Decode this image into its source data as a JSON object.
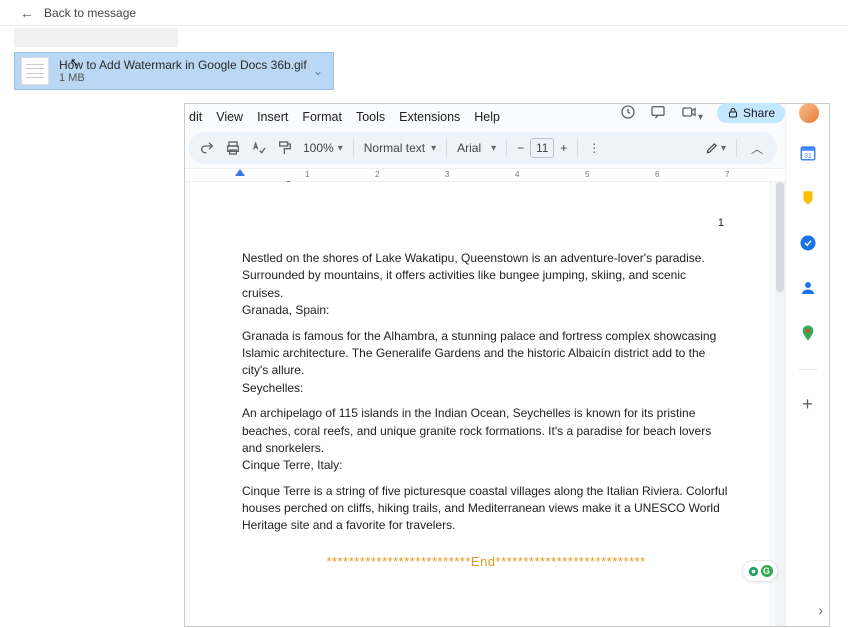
{
  "back_link": "Back to message",
  "attachment": {
    "name": "How to Add Watermark in Google Docs 36b.gif",
    "size": "1 MB"
  },
  "menus": {
    "edit": "dit",
    "view": "View",
    "insert": "Insert",
    "format": "Format",
    "tools": "Tools",
    "extensions": "Extensions",
    "help": "Help"
  },
  "toolbar": {
    "zoom": "100%",
    "style": "Normal text",
    "font": "Arial",
    "fontsize": "11",
    "share": "Share"
  },
  "doc": {
    "page_number": "1",
    "p1": "Nestled on the shores of Lake Wakatipu, Queenstown is an adventure-lover's paradise. Surrounded by mountains, it offers activities like bungee jumping, skiing, and scenic cruises.",
    "h2": "Granada, Spain:",
    "p2": "Granada is famous for the Alhambra, a stunning palace and fortress complex showcasing Islamic architecture. The Generalife Gardens and the historic Albaicín district add to the city's allure.",
    "h3": "Seychelles:",
    "p3": "An archipelago of 115 islands in the Indian Ocean, Seychelles is known for its pristine beaches, coral reefs, and unique granite rock formations. It's a paradise for beach lovers and snorkelers.",
    "h4": "Cinque Terre, Italy:",
    "p4": "Cinque Terre is a string of five picturesque coastal villages along the Italian Riviera. Colorful houses perched on cliffs, hiking trails, and Mediterranean views make it a UNESCO World Heritage site and a favorite for travelers.",
    "end": "**************************End***************************"
  },
  "ruler_marks": [
    "1",
    "2",
    "3",
    "4",
    "5",
    "6",
    "7"
  ]
}
